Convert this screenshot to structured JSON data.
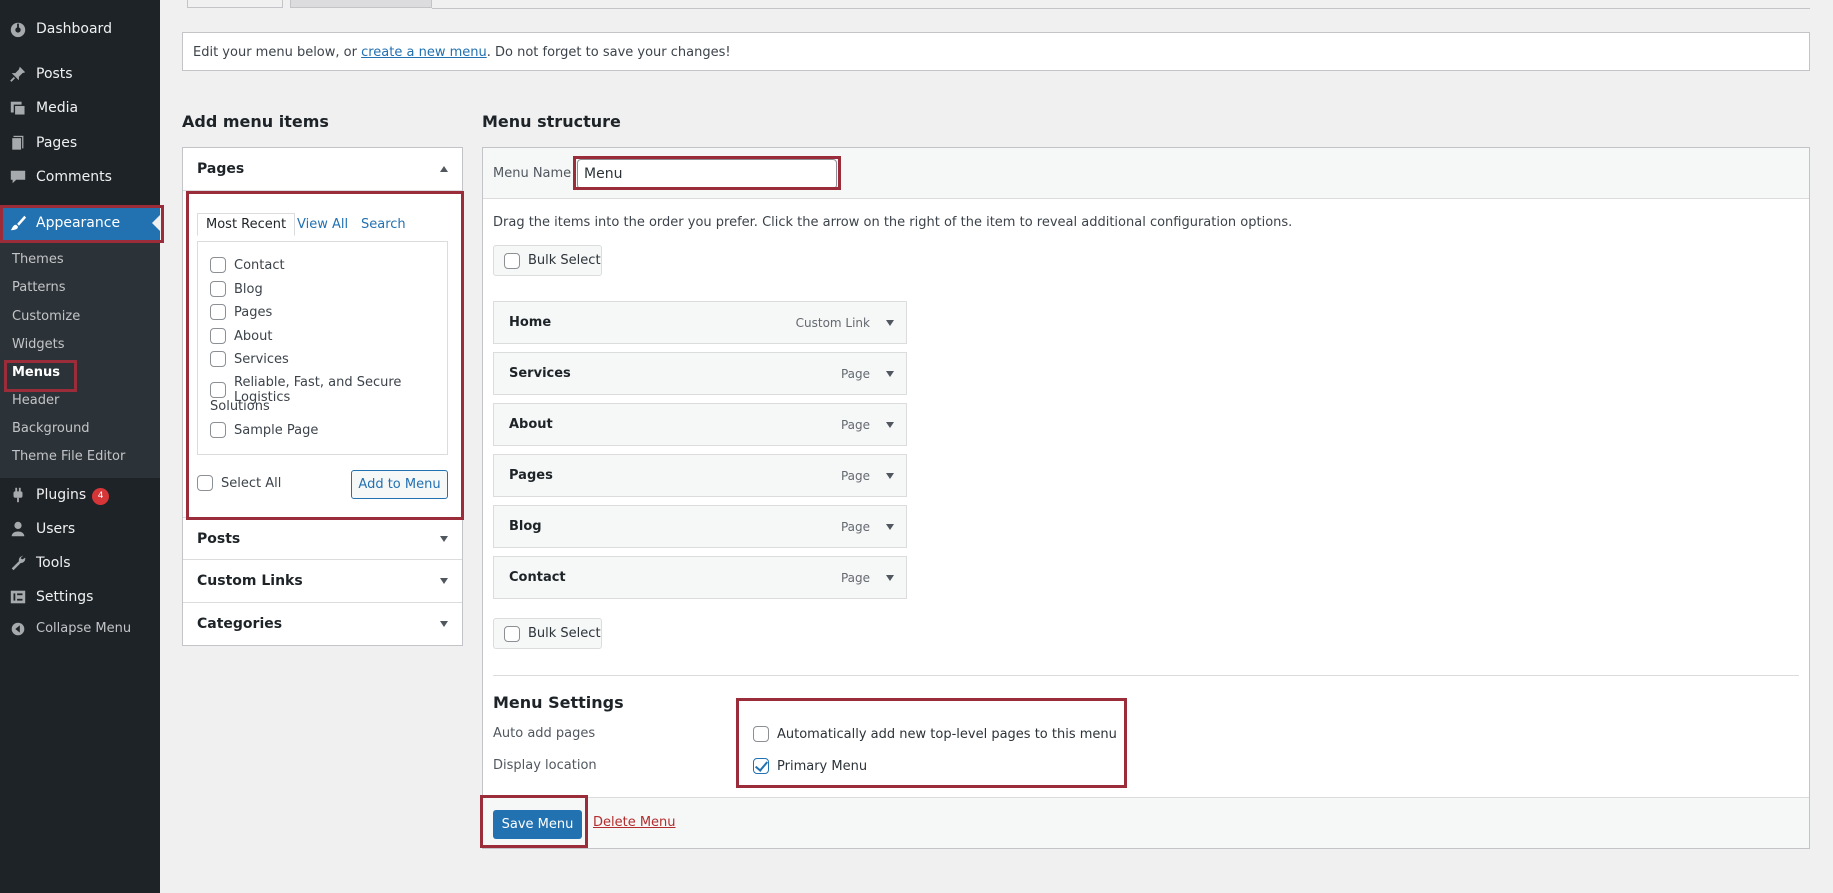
{
  "sidebar": {
    "items": [
      {
        "label": "Dashboard",
        "icon": "dashboard-icon"
      },
      {
        "label": "Posts",
        "icon": "pushpin-icon"
      },
      {
        "label": "Media",
        "icon": "media-icon"
      },
      {
        "label": "Pages",
        "icon": "pages-icon"
      },
      {
        "label": "Comments",
        "icon": "comment-icon"
      },
      {
        "label": "Appearance",
        "icon": "paintbrush-icon"
      },
      {
        "label": "Plugins",
        "icon": "plugin-icon",
        "badge": "4"
      },
      {
        "label": "Users",
        "icon": "user-icon"
      },
      {
        "label": "Tools",
        "icon": "wrench-icon"
      },
      {
        "label": "Settings",
        "icon": "settings-icon"
      },
      {
        "label": "Collapse Menu",
        "icon": "collapse-icon"
      }
    ],
    "submenu": [
      "Themes",
      "Patterns",
      "Customize",
      "Widgets",
      "Menus",
      "Header",
      "Background",
      "Theme File Editor"
    ]
  },
  "notice": {
    "before": "Edit your menu below, or ",
    "link": "create a new menu",
    "after": ". Do not forget to save your changes!"
  },
  "add_items": {
    "heading": "Add menu items",
    "sections": [
      "Pages",
      "Posts",
      "Custom Links",
      "Categories"
    ],
    "tabs": [
      "Most Recent",
      "View All",
      "Search"
    ],
    "pages": [
      "Contact",
      "Blog",
      "Pages",
      "About",
      "Services",
      "Reliable, Fast, and Secure Logistics",
      "Solutions",
      "Sample Page"
    ],
    "select_all": "Select All",
    "add_button": "Add to Menu"
  },
  "structure": {
    "heading": "Menu structure",
    "menu_name_label": "Menu Name",
    "menu_name_value": "Menu",
    "instructions": "Drag the items into the order you prefer. Click the arrow on the right of the item to reveal additional configuration options.",
    "bulk_select": "Bulk Select",
    "items": [
      {
        "name": "Home",
        "type": "Custom Link"
      },
      {
        "name": "Services",
        "type": "Page"
      },
      {
        "name": "About",
        "type": "Page"
      },
      {
        "name": "Pages",
        "type": "Page"
      },
      {
        "name": "Blog",
        "type": "Page"
      },
      {
        "name": "Contact",
        "type": "Page"
      }
    ]
  },
  "settings": {
    "heading": "Menu Settings",
    "auto_add_label": "Auto add pages",
    "auto_add_option": "Automatically add new top-level pages to this menu",
    "auto_add_checked": false,
    "display_location_label": "Display location",
    "display_location_option": "Primary Menu",
    "display_location_checked": true
  },
  "actions": {
    "save": "Save Menu",
    "delete": "Delete Menu"
  },
  "colors": {
    "sidebar_bg": "#1d2327",
    "accent": "#2271b1",
    "highlight_border": "#9b2d3b",
    "delete": "#b32d2e",
    "badge": "#d63638"
  }
}
